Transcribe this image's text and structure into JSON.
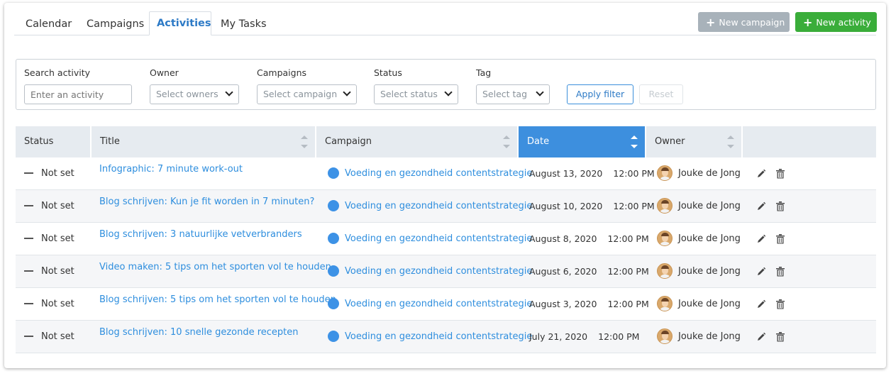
{
  "tabs": [
    {
      "label": "Calendar"
    },
    {
      "label": "Campaigns"
    },
    {
      "label": "Activities",
      "active": true
    },
    {
      "label": "My Tasks"
    }
  ],
  "header_buttons": {
    "new_campaign": "New campaign",
    "new_activity": "New activity"
  },
  "filters": {
    "search_label": "Search activity",
    "search_placeholder": "Enter an activity",
    "owner_label": "Owner",
    "owner_value": "Select owners",
    "campaigns_label": "Campaigns",
    "campaigns_value": "Select campaign",
    "status_label": "Status",
    "status_value": "Select status",
    "tag_label": "Tag",
    "tag_value": "Select tag",
    "apply_label": "Apply filter",
    "reset_label": "Reset"
  },
  "table": {
    "columns": [
      "Status",
      "Title",
      "Campaign",
      "Date",
      "Owner"
    ],
    "sorted_column": "Date",
    "rows": [
      {
        "status": "Not set",
        "title": "Infographic: 7 minute work-out",
        "campaign": "Voeding en gezondheid contentstrategie",
        "date": "August 13, 2020",
        "time": "12:00 PM",
        "owner": "Jouke de Jong"
      },
      {
        "status": "Not set",
        "title": "Blog schrijven: Kun je fit worden in 7 minuten?",
        "campaign": "Voeding en gezondheid contentstrategie",
        "date": "August 10, 2020",
        "time": "12:00 PM",
        "owner": "Jouke de Jong"
      },
      {
        "status": "Not set",
        "title": "Blog schrijven: 3 natuurlijke vetverbranders",
        "campaign": "Voeding en gezondheid contentstrategie",
        "date": "August 8, 2020",
        "time": "12:00 PM",
        "owner": "Jouke de Jong"
      },
      {
        "status": "Not set",
        "title": "Video maken: 5 tips om het sporten vol te houden",
        "campaign": "Voeding en gezondheid contentstrategie",
        "date": "August 6, 2020",
        "time": "12:00 PM",
        "owner": "Jouke de Jong"
      },
      {
        "status": "Not set",
        "title": "Blog schrijven: 5 tips om het sporten vol te houden",
        "campaign": "Voeding en gezondheid contentstrategie",
        "date": "August 3, 2020",
        "time": "12:00 PM",
        "owner": "Jouke de Jong"
      },
      {
        "status": "Not set",
        "title": "Blog schrijven: 10 snelle gezonde recepten",
        "campaign": "Voeding en gezondheid contentstrategie",
        "date": "July 21, 2020",
        "time": "12:00 PM",
        "owner": "Jouke de Jong"
      }
    ]
  },
  "colors": {
    "accent": "#3d8fde",
    "green": "#3aad3a",
    "grey_button": "#a8b2ba"
  }
}
